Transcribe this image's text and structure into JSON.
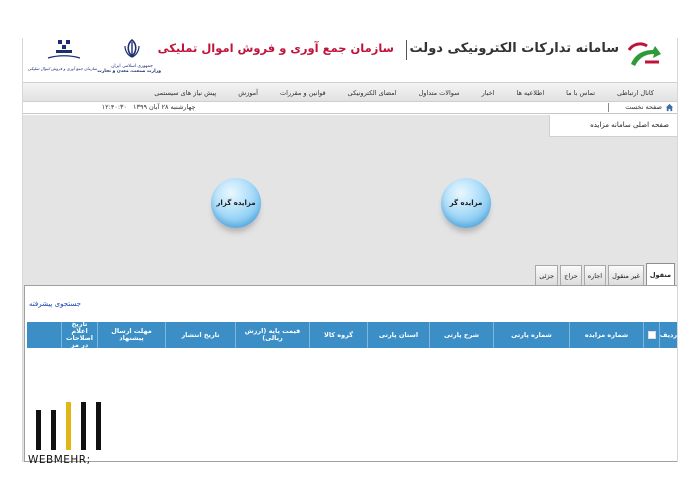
{
  "header": {
    "brand_title": "سامانه تدارکات الکترونیکی دولت",
    "org_title": "سازمان جمع آوری و فروش اموال تملیکی",
    "ministry_caption_1": "جمهوری اسلامی ایران",
    "ministry_caption_2": "وزارت صنعت، معدن و تجارت",
    "gov_caption": "سازمان جمع آوری و فروش اموال تملیکی",
    "brand_color": "#c0133a",
    "logo_color": "#2f9a3a"
  },
  "nav": {
    "items": [
      "پیش نیاز های سیستمی",
      "آموزش",
      "قوانین و مقررات",
      "امضای الکترونیکی",
      "سوالات متداول",
      "اخبار",
      "اطلاعیه ها",
      "تماس با ما",
      "کانال ارتباطی"
    ]
  },
  "crumb": {
    "home": "صفحه نخست",
    "date": "چهارشنبه ۲۸ آبان ۱۳۹۹",
    "time": "۱۲:۴۰:۳۰"
  },
  "main": {
    "page_label": "صفحه اصلی سامانه مزایده",
    "bidder_button": "مزایده گر",
    "auctioneer_button": "مزایده گزار"
  },
  "tabs": [
    {
      "label": "منقول",
      "active": true
    },
    {
      "label": "غیر منقول",
      "active": false
    },
    {
      "label": "اجاره",
      "active": false
    },
    {
      "label": "حراج",
      "active": false
    },
    {
      "label": "جزئی",
      "active": false
    }
  ],
  "search": {
    "advanced_label": "جستجوی پیشرفته"
  },
  "grid": {
    "header_color": "#3b8fc6",
    "columns": [
      {
        "key": "row",
        "label": "ردیف",
        "w": 18
      },
      {
        "key": "check",
        "label": "",
        "w": 16
      },
      {
        "key": "auction_no",
        "label": "شماره مزایده",
        "w": 74
      },
      {
        "key": "party_no",
        "label": "شماره پارتی",
        "w": 76
      },
      {
        "key": "party_desc",
        "label": "شرح پارتی",
        "w": 64
      },
      {
        "key": "party_prov",
        "label": "استان پارتی",
        "w": 62
      },
      {
        "key": "group",
        "label": "گروه کالا",
        "w": 58
      },
      {
        "key": "base_price",
        "label": "قیمت پایه (ارزش ریالی)",
        "w": 74
      },
      {
        "key": "pub_date",
        "label": "تاریخ انتشار",
        "w": 70
      },
      {
        "key": "deadline",
        "label": "مهلت ارسال پیشنهاد",
        "w": 68
      },
      {
        "key": "corrections",
        "label": "تاریخ اعلام اصلاحات در مز",
        "w": 36
      }
    ],
    "rows": []
  },
  "watermark": {
    "text": "WEBMEHR;"
  }
}
